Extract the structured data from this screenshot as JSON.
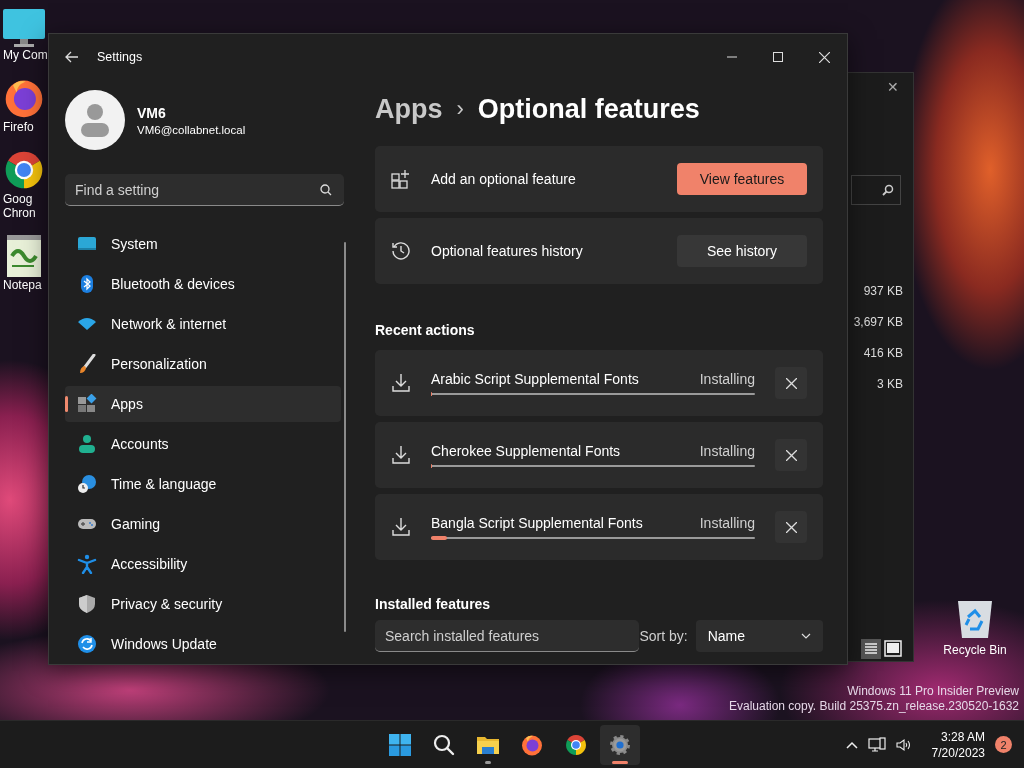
{
  "desktop_icons": [
    {
      "kind": "computer",
      "lines": [
        "My Com"
      ]
    },
    {
      "kind": "firefox",
      "lines": [
        "Firefo"
      ]
    },
    {
      "kind": "chrome",
      "lines": [
        "Goog",
        "Chron"
      ]
    },
    {
      "kind": "notepad",
      "lines": [
        "Notepa"
      ]
    }
  ],
  "recycle_bin": {
    "label": "Recycle Bin"
  },
  "background_window": {
    "close": "✕",
    "sizes": [
      "937 KB",
      "3,697 KB",
      "416 KB",
      "3 KB"
    ]
  },
  "settings": {
    "title": "Settings",
    "user": {
      "name": "VM6",
      "email": "VM6@collabnet.local"
    },
    "search": {
      "placeholder": "Find a setting"
    },
    "nav": [
      {
        "kind": "system",
        "label": "System",
        "selected": false
      },
      {
        "kind": "bluetooth",
        "label": "Bluetooth & devices",
        "selected": false
      },
      {
        "kind": "network",
        "label": "Network & internet",
        "selected": false
      },
      {
        "kind": "personalization",
        "label": "Personalization",
        "selected": false
      },
      {
        "kind": "apps",
        "label": "Apps",
        "selected": true
      },
      {
        "kind": "accounts",
        "label": "Accounts",
        "selected": false
      },
      {
        "kind": "time",
        "label": "Time & language",
        "selected": false
      },
      {
        "kind": "gaming",
        "label": "Gaming",
        "selected": false
      },
      {
        "kind": "accessibility",
        "label": "Accessibility",
        "selected": false
      },
      {
        "kind": "privacy",
        "label": "Privacy & security",
        "selected": false
      },
      {
        "kind": "update",
        "label": "Windows Update",
        "selected": false
      }
    ],
    "breadcrumb": {
      "parent": "Apps",
      "separator": "›",
      "current": "Optional features"
    },
    "feature_actions": [
      {
        "kind": "add",
        "label": "Add an optional feature",
        "button": "View features",
        "primary": true
      },
      {
        "kind": "history",
        "label": "Optional features history",
        "button": "See history",
        "primary": false
      }
    ],
    "recent_heading": "Recent actions",
    "recent_actions": [
      {
        "name": "Arabic Script Supplemental Fonts",
        "status": "Installing",
        "level": 0
      },
      {
        "name": "Cherokee Supplemental Fonts",
        "status": "Installing",
        "level": 0
      },
      {
        "name": "Bangla Script Supplemental Fonts",
        "status": "Installing",
        "level": 0.05
      }
    ],
    "installed_heading": "Installed features",
    "installed_search": {
      "placeholder": "Search installed features"
    },
    "sort": {
      "label": "Sort by:",
      "value": "Name"
    }
  },
  "edition_notice": [
    "Windows 11 Pro Insider Preview",
    "Evaluation copy. Build 25375.zn_release.230520-1632"
  ],
  "taskbar": {
    "apps": [
      {
        "kind": "start",
        "selected": false,
        "running": false
      },
      {
        "kind": "search",
        "selected": false,
        "running": false
      },
      {
        "kind": "files",
        "selected": false,
        "running": true
      },
      {
        "kind": "firefox",
        "selected": false,
        "running": false
      },
      {
        "kind": "chrome",
        "selected": false,
        "running": false
      },
      {
        "kind": "settings",
        "selected": true,
        "running": true
      }
    ],
    "clock": {
      "time": "3:28 AM",
      "date": "7/20/2023"
    },
    "notification_count": "2"
  }
}
